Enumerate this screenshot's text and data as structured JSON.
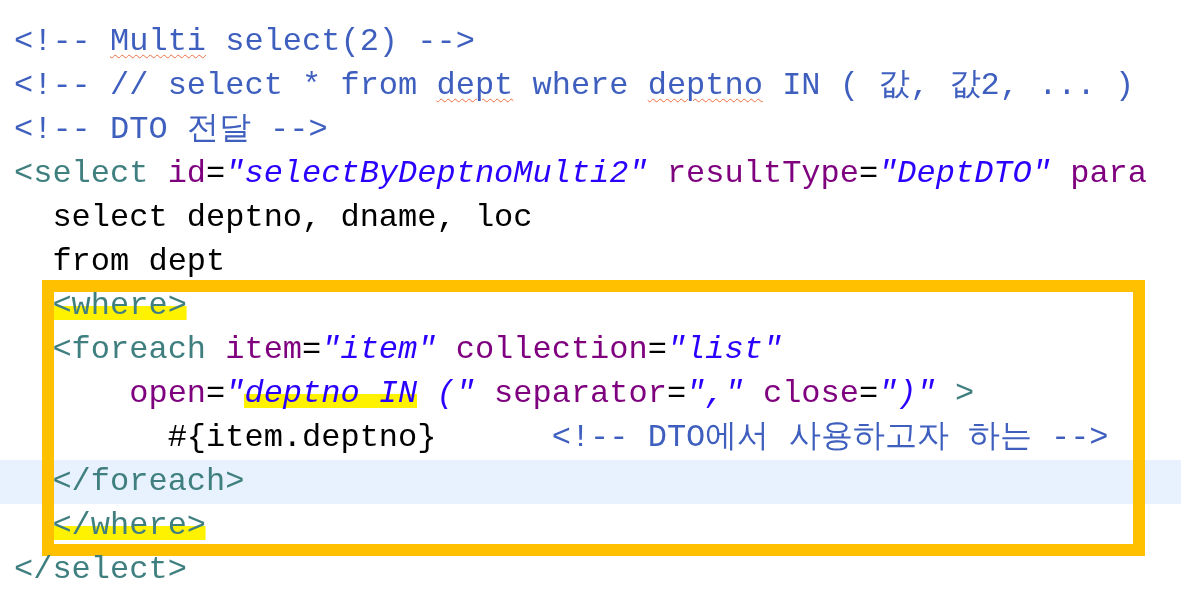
{
  "editor": {
    "blocks": [
      {
        "boxed": false,
        "lines": [
          {
            "current": false,
            "tokens": [
              {
                "kind": "comment",
                "text": "<!-- "
              },
              {
                "kind": "comment-misspelled",
                "text": "Multi"
              },
              {
                "kind": "comment",
                "text": " select(2) -->"
              }
            ]
          },
          {
            "current": false,
            "tokens": [
              {
                "kind": "comment",
                "text": "<!-- // select * from "
              },
              {
                "kind": "comment-misspelled",
                "text": "dept"
              },
              {
                "kind": "comment",
                "text": " where "
              },
              {
                "kind": "comment-misspelled",
                "text": "deptno"
              },
              {
                "kind": "comment",
                "text": " IN ( 값, 값2, ... )"
              }
            ]
          },
          {
            "current": false,
            "tokens": [
              {
                "kind": "comment",
                "text": "<!-- DTO 전달 -->"
              }
            ]
          },
          {
            "current": false,
            "tokens": [
              {
                "kind": "tag",
                "text": "<select"
              },
              {
                "kind": "attr",
                "text": " id"
              },
              {
                "kind": "eq",
                "text": "="
              },
              {
                "kind": "string",
                "text": "\"selectByDeptnoMulti2\""
              },
              {
                "kind": "attr",
                "text": " resultType"
              },
              {
                "kind": "eq",
                "text": "="
              },
              {
                "kind": "string",
                "text": "\"DeptDTO\""
              },
              {
                "kind": "attr",
                "text": " para"
              }
            ]
          },
          {
            "current": false,
            "tokens": [
              {
                "kind": "text",
                "text": "  select deptno, dname, loc"
              }
            ]
          },
          {
            "current": false,
            "tokens": [
              {
                "kind": "text",
                "text": "  from dept"
              }
            ]
          }
        ]
      },
      {
        "boxed": true,
        "lines": [
          {
            "current": false,
            "tokens": [
              {
                "kind": "tag-marked",
                "text": "  <where>"
              }
            ]
          },
          {
            "current": false,
            "tokens": [
              {
                "kind": "tag",
                "text": "  <foreach"
              },
              {
                "kind": "attr",
                "text": " item"
              },
              {
                "kind": "eq",
                "text": "="
              },
              {
                "kind": "string",
                "text": "\"item\""
              },
              {
                "kind": "attr",
                "text": " collection"
              },
              {
                "kind": "eq",
                "text": "="
              },
              {
                "kind": "string",
                "text": "\"list\""
              }
            ]
          },
          {
            "current": false,
            "tokens": [
              {
                "kind": "attr",
                "text": "      open"
              },
              {
                "kind": "eq",
                "text": "="
              },
              {
                "kind": "string",
                "text": "\""
              },
              {
                "kind": "string-marked",
                "text": "deptno IN"
              },
              {
                "kind": "string",
                "text": " (\""
              },
              {
                "kind": "attr",
                "text": " separator"
              },
              {
                "kind": "eq",
                "text": "="
              },
              {
                "kind": "string",
                "text": "\",\""
              },
              {
                "kind": "attr",
                "text": " close"
              },
              {
                "kind": "eq",
                "text": "="
              },
              {
                "kind": "string",
                "text": "\")\""
              },
              {
                "kind": "tag",
                "text": " >"
              }
            ]
          },
          {
            "current": false,
            "tokens": [
              {
                "kind": "text",
                "text": "        #{item.deptno}      "
              },
              {
                "kind": "comment",
                "text": "<!-- DTO에서 사용하고자 하는 -->"
              }
            ]
          },
          {
            "current": true,
            "tokens": [
              {
                "kind": "tag",
                "text": "  </foreach>"
              }
            ]
          },
          {
            "current": false,
            "tokens": [
              {
                "kind": "tag-marked",
                "text": "  </where>"
              }
            ]
          }
        ]
      },
      {
        "boxed": false,
        "lines": [
          {
            "current": false,
            "tokens": [
              {
                "kind": "tag",
                "text": "</select>"
              }
            ]
          }
        ]
      }
    ]
  }
}
